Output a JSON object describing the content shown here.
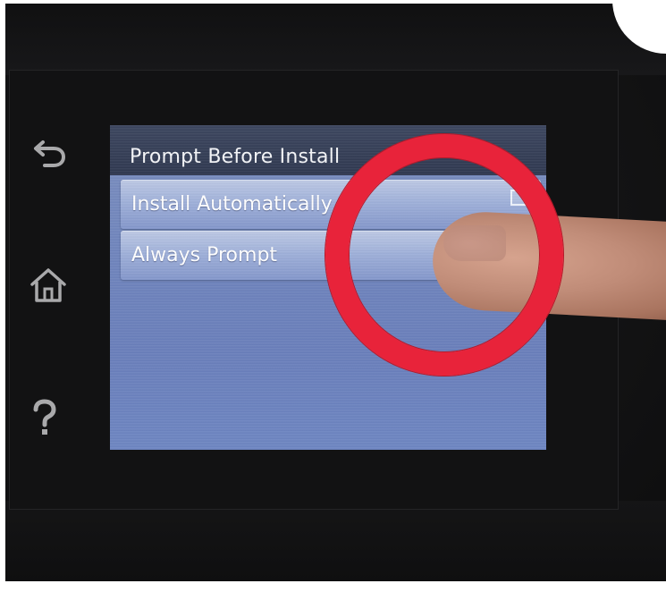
{
  "screen": {
    "title": "Prompt Before Install",
    "items": [
      {
        "label": "Install Automatically",
        "selected": true
      },
      {
        "label": "Always Prompt",
        "selected": false
      }
    ]
  },
  "nav": {
    "back_icon": "back-arrow-icon",
    "home_icon": "home-icon",
    "help_icon": "help-question-icon"
  },
  "colors": {
    "screen_background": "#7186bd",
    "header_background": "#2f3850",
    "menu_item_background": "#9fb0d9",
    "highlight_ring": "#e8233a",
    "bezel": "#141415"
  }
}
